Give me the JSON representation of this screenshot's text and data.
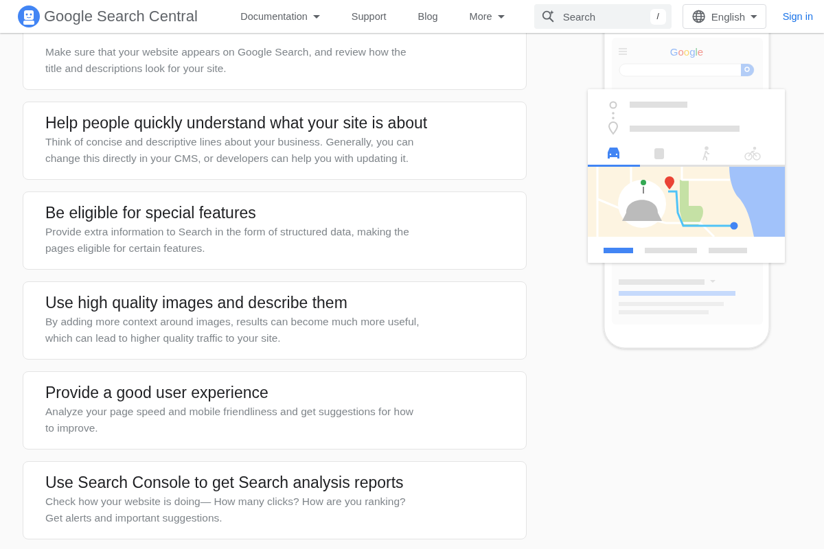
{
  "header": {
    "logo_text": "Google Search Central",
    "nav": [
      {
        "label": "Documentation",
        "has_menu": true
      },
      {
        "label": "Support",
        "has_menu": false
      },
      {
        "label": "Blog",
        "has_menu": false
      },
      {
        "label": "More",
        "has_menu": true
      }
    ],
    "search": {
      "placeholder": "Search",
      "shortcut": "/"
    },
    "language": {
      "label": "English"
    },
    "sign_in": "Sign in"
  },
  "cards": [
    {
      "description": "Make sure that your website appears on Google Search, and review how the title and descriptions look for your site."
    },
    {
      "title": "Help people quickly understand what your site is about",
      "description": "Think of concise and descriptive lines about your business. Generally, you can change this directly in your CMS, or developers can help you with updating it."
    },
    {
      "title": "Be eligible for special features",
      "description": "Provide extra information to Search in the form of structured data, making the pages eligible for certain features."
    },
    {
      "title": "Use high quality images and describe them",
      "description": "By adding more context around images, results can become much more useful, which can lead to higher quality traffic to your site."
    },
    {
      "title": "Provide a good user experience",
      "description": "Analyze your page speed and mobile friendliness and get suggestions for how to improve."
    },
    {
      "title": "Use Search Console to get Search analysis reports",
      "description": "Check how your website is doing— How many clicks? How are you ranking? Get alerts and important suggestions."
    }
  ],
  "illustration": {
    "logo_text": "Google"
  }
}
